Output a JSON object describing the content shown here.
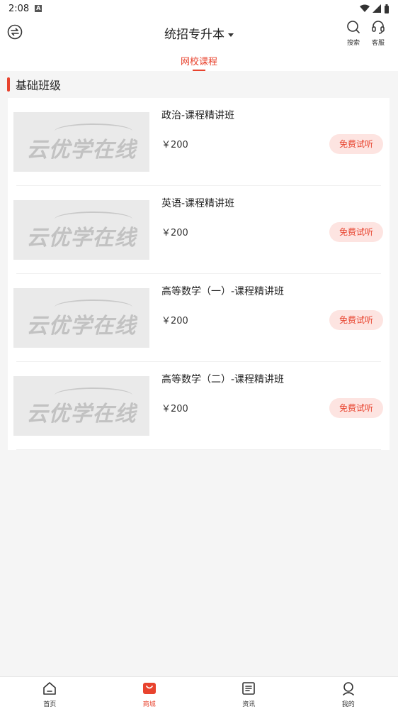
{
  "status_bar": {
    "time": "2:08",
    "notif": "A"
  },
  "header": {
    "title": "统招专升本",
    "search_label": "搜索",
    "service_label": "客服"
  },
  "tabs": [
    {
      "label": "网校课程",
      "active": true
    }
  ],
  "section": {
    "title": "基础班级"
  },
  "thumb_watermark": "云优学在线",
  "courses": [
    {
      "name": "政治-课程精讲班",
      "price": "￥200",
      "action": "免费试听"
    },
    {
      "name": "英语-课程精讲班",
      "price": "￥200",
      "action": "免费试听"
    },
    {
      "name": "高等数学（一）-课程精讲班",
      "price": "￥200",
      "action": "免费试听"
    },
    {
      "name": "高等数学（二）-课程精讲班",
      "price": "￥200",
      "action": "免费试听"
    }
  ],
  "bottom_nav": [
    {
      "label": "首页",
      "icon": "home-icon",
      "active": false
    },
    {
      "label": "商城",
      "icon": "shop-bag-icon",
      "active": true
    },
    {
      "label": "资讯",
      "icon": "news-icon",
      "active": false
    },
    {
      "label": "我的",
      "icon": "profile-icon",
      "active": false
    }
  ],
  "colors": {
    "accent": "#e8432e",
    "accent_light": "#fde4e1"
  }
}
